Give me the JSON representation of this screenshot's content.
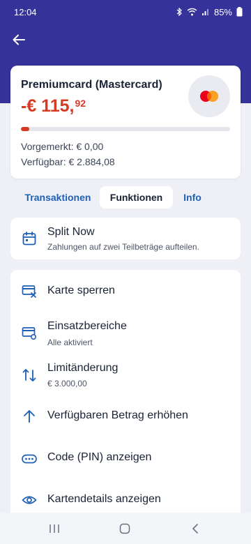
{
  "status_bar": {
    "time": "12:04",
    "battery": "85%"
  },
  "card": {
    "title": "Premiumcard (Mastercard)",
    "amount_main": "-€ 115,",
    "amount_cents": "92",
    "usage_fraction": 0.04,
    "pending": "Vorgemerkt: € 0,00",
    "available": "Verfügbar: € 2.884,08"
  },
  "tabs": [
    {
      "label": "Transaktionen"
    },
    {
      "label": "Funktionen",
      "active": true
    },
    {
      "label": "Info"
    }
  ],
  "split_now": {
    "title": "Split Now",
    "subtitle": "Zahlungen auf zwei Teilbeträge aufteilen."
  },
  "functions": [
    {
      "title": "Karte sperren",
      "icon": "card-lock-icon"
    },
    {
      "title": "Einsatzbereiche",
      "subtitle": "Alle aktiviert",
      "icon": "card-settings-icon"
    },
    {
      "title": "Limitänderung",
      "subtitle": "€ 3.000,00",
      "icon": "swap-vertical-icon"
    },
    {
      "title": "Verfügbaren Betrag erhöhen",
      "icon": "arrow-up-icon"
    },
    {
      "title": "Code (PIN) anzeigen",
      "icon": "pin-dots-icon"
    },
    {
      "title": "Kartendetails anzeigen",
      "icon": "eye-icon"
    }
  ],
  "colors": {
    "header": "#35339a",
    "accent": "#1f5fb5",
    "negative": "#d63a22"
  }
}
